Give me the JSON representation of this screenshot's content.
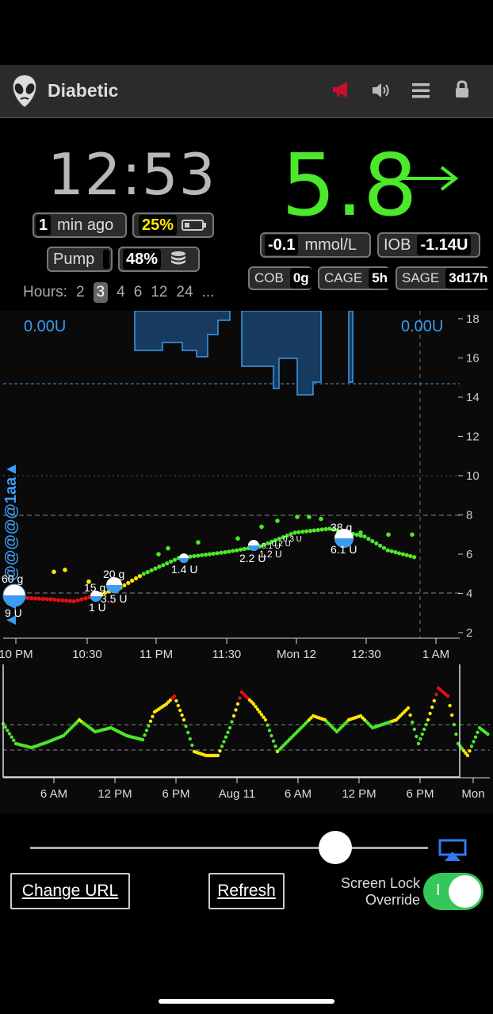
{
  "header": {
    "title": "Diabetic",
    "alarm_color": "#c8102e"
  },
  "clock": {
    "time": "12:53",
    "ago_value": "1",
    "ago_label": "min ago",
    "phone_battery": "25%",
    "phone_battery_color": "#ffe600"
  },
  "pump": {
    "label": "Pump",
    "reservoir": "48%"
  },
  "glucose": {
    "value": "5.8",
    "arrow": "→",
    "color": "#4be82b",
    "delta": "-0.1",
    "units": "mmol/L",
    "iob_label": "IOB",
    "iob": "-1.14U"
  },
  "pills": {
    "cob_label": "COB",
    "cob": "0g",
    "cage_label": "CAGE",
    "cage": "5h",
    "sage_label": "SAGE",
    "sage": "3d17h"
  },
  "hours": {
    "label": "Hours:",
    "options": [
      "2",
      "3",
      "4",
      "6",
      "12",
      "24",
      "..."
    ],
    "active": "3"
  },
  "chart": {
    "basal_left": "0.00U",
    "basal_right": "0.00U",
    "y_ticks": [
      "18",
      "16",
      "14",
      "12",
      "10",
      "8",
      "6",
      "4",
      "2"
    ],
    "x_ticks": [
      "10 PM",
      "10:30",
      "11 PM",
      "11:30",
      "Mon 12",
      "12:30",
      "1 AM"
    ],
    "side_text": "▲▲▲@@@@@1aa▲",
    "treatments": [
      "60 g",
      "9 U",
      "15 g",
      "1 U",
      "20 g",
      "3.5 U",
      "1.4 U",
      "2.2 U",
      "1.2 U",
      "0.1 U",
      "0.2 U",
      "0.3 U",
      "38 g",
      "6.1 U"
    ]
  },
  "chart_data": {
    "type": "scatter",
    "title": "",
    "xlabel": "",
    "ylabel": "",
    "ylim": [
      2,
      18
    ],
    "x_ticks": [
      "10 PM",
      "10:30",
      "11 PM",
      "11:30",
      "Mon 12",
      "12:30",
      "1 AM"
    ],
    "series": [
      {
        "name": "",
        "x": [
          "10:00",
          "10:15",
          "10:25",
          "10:35",
          "10:45",
          "10:55",
          "11:10",
          "11:30",
          "11:45",
          "12:00",
          "12:15",
          "12:30",
          "12:40",
          "12:53"
        ],
        "y": [
          3.8,
          3.7,
          3.6,
          3.9,
          4.3,
          5.0,
          5.8,
          6.1,
          6.4,
          7.1,
          7.3,
          6.9,
          6.2,
          5.8
        ]
      }
    ]
  },
  "history": {
    "x_ticks": [
      "6 AM",
      "12 PM",
      "6 PM",
      "Aug 11",
      "6 AM",
      "12 PM",
      "6 PM",
      "Mon"
    ]
  },
  "controls": {
    "change_url": "Change URL",
    "refresh": "Refresh",
    "lock_line1": "Screen Lock",
    "lock_line2": "Override",
    "toggle_state": "I"
  }
}
